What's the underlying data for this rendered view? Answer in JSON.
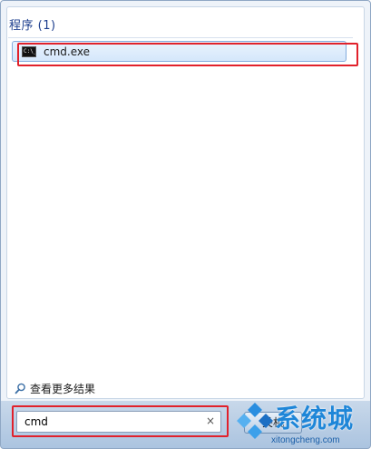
{
  "results": {
    "section_title": "程序 (1)",
    "items": [
      {
        "label": "cmd.exe",
        "icon": "console-icon"
      }
    ],
    "see_more_label": "查看更多结果"
  },
  "search": {
    "value": "cmd",
    "clear_glyph": "×"
  },
  "footer": {
    "shutdown_label": "关机"
  },
  "watermark": {
    "logo_text": "系统城",
    "domain": "xitongcheng.com"
  },
  "colors": {
    "highlight": "#e1212b",
    "selection": "#d5e7fb",
    "title": "#1e3f8e",
    "watermark": "#1e86d8"
  }
}
